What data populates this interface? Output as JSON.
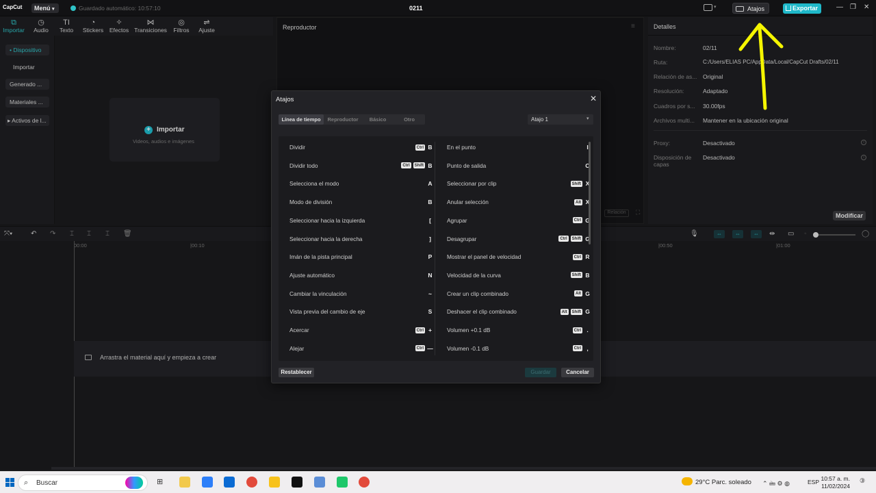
{
  "app": {
    "logo": "CapCut",
    "menu": "Menú",
    "autosave": "Guardado automático: 10:57:10",
    "project": "0211"
  },
  "topbar": {
    "shortcuts": "Atajos",
    "export": "Exportar",
    "min": "—",
    "max": "❐",
    "close": "✕"
  },
  "toolbar": [
    {
      "label": "Importar",
      "icon": "⧉"
    },
    {
      "label": "Audio",
      "icon": "◷"
    },
    {
      "label": "Texto",
      "icon": "TI"
    },
    {
      "label": "Stickers",
      "icon": "◔"
    },
    {
      "label": "Efectos",
      "icon": "✧"
    },
    {
      "label": "Transiciones",
      "icon": "⋈"
    },
    {
      "label": "Filtros",
      "icon": "◎"
    },
    {
      "label": "Ajuste",
      "icon": "⇌"
    }
  ],
  "leftnav": [
    {
      "label": "• Dispositivo"
    },
    {
      "label": "Importar"
    },
    {
      "label": "Generado ..."
    },
    {
      "label": "Materiales ..."
    },
    {
      "label": "▸ Activos de l..."
    }
  ],
  "media": {
    "import_label": "Importar",
    "import_sub": "Videos, audios e imágenes"
  },
  "player": {
    "title": "Reproductor",
    "ratio": "Relación"
  },
  "details": {
    "title": "Detalles",
    "rows": [
      {
        "label": "Nombre:",
        "value": "02/11"
      },
      {
        "label": "Ruta:",
        "value": "C:/Users/ELIAS PC/AppData/Local/CapCut Drafts/02/11"
      },
      {
        "label": "Relación de as...",
        "value": "Original"
      },
      {
        "label": "Resolución:",
        "value": "Adaptado"
      },
      {
        "label": "Cuadros por s...",
        "value": "30.00fps"
      },
      {
        "label": "Archivos multi...",
        "value": "Mantener en la ubicación original"
      }
    ],
    "proxy_label": "Proxy:",
    "proxy_value": "Desactivado",
    "layers_label": "Disposición de capas",
    "layers_value": "Desactivado",
    "modify": "Modificar"
  },
  "timeline": {
    "ticks": [
      "00:00",
      "|00:10",
      "|00:50",
      "|01:00"
    ],
    "drop_hint": "Arrastra el material aquí y empieza a crear"
  },
  "dialog": {
    "title": "Atajos",
    "tabs": [
      "Línea de tiempo",
      "Reproductor",
      "Básico",
      "Otro"
    ],
    "preset": "Atajo 1",
    "left": [
      {
        "label": "Dividir",
        "mods": [
          "Ctrl"
        ],
        "key": "B"
      },
      {
        "label": "Dividir todo",
        "mods": [
          "Ctrl",
          "Shift"
        ],
        "key": "B"
      },
      {
        "label": "Selecciona el modo",
        "mods": [],
        "key": "A"
      },
      {
        "label": "Modo de división",
        "mods": [],
        "key": "B"
      },
      {
        "label": "Seleccionar hacia la izquierda",
        "mods": [],
        "key": "["
      },
      {
        "label": "Seleccionar hacia la derecha",
        "mods": [],
        "key": "]"
      },
      {
        "label": "Imán de la pista principal",
        "mods": [],
        "key": "P"
      },
      {
        "label": "Ajuste automático",
        "mods": [],
        "key": "N"
      },
      {
        "label": "Cambiar la vinculación",
        "mods": [],
        "key": "~"
      },
      {
        "label": "Vista previa del cambio de eje",
        "mods": [],
        "key": "S"
      },
      {
        "label": "Acercar",
        "mods": [
          "Ctrl"
        ],
        "key": "+"
      },
      {
        "label": "Alejar",
        "mods": [
          "Ctrl"
        ],
        "key": "—"
      }
    ],
    "right": [
      {
        "label": "En el punto",
        "mods": [],
        "key": "I"
      },
      {
        "label": "Punto de salida",
        "mods": [],
        "key": "O"
      },
      {
        "label": "Seleccionar por clip",
        "mods": [
          "Shift"
        ],
        "key": "X"
      },
      {
        "label": "Anular selección",
        "mods": [
          "Alt"
        ],
        "key": "X"
      },
      {
        "label": "Agrupar",
        "mods": [
          "Ctrl"
        ],
        "key": "G"
      },
      {
        "label": "Desagrupar",
        "mods": [
          "Ctrl",
          "Shift"
        ],
        "key": "G"
      },
      {
        "label": "Mostrar el panel de velocidad",
        "mods": [
          "Ctrl"
        ],
        "key": "R"
      },
      {
        "label": "Velocidad de la curva",
        "mods": [
          "Shift"
        ],
        "key": "B"
      },
      {
        "label": "Crear un clip combinado",
        "mods": [
          "Alt"
        ],
        "key": "G"
      },
      {
        "label": "Deshacer el clip combinado",
        "mods": [
          "Alt",
          "Shift"
        ],
        "key": "G"
      },
      {
        "label": "Volumen +0.1 dB",
        "mods": [
          "Ctrl"
        ],
        "key": "."
      },
      {
        "label": "Volumen -0.1 dB",
        "mods": [
          "Ctrl"
        ],
        "key": ","
      }
    ],
    "reset": "Restablecer",
    "save": "Guardar",
    "cancel": "Cancelar"
  },
  "taskbar": {
    "search": "Buscar",
    "weather": "29°C  Parc. soleado",
    "lang": "ESP",
    "time": "10:57 a. m.",
    "date": "11/02/2024"
  },
  "colors": {
    "accent": "#1fb8c9",
    "annotation": "#f5f500"
  }
}
